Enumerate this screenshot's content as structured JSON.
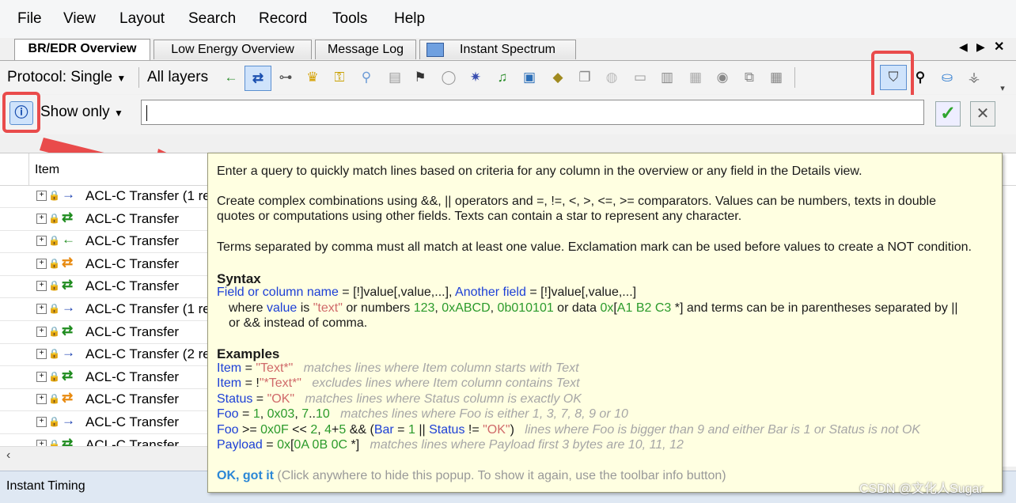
{
  "menu": [
    "File",
    "View",
    "Layout",
    "Search",
    "Record",
    "Tools",
    "Help"
  ],
  "tabs": [
    {
      "label": "BR/EDR Overview",
      "active": true
    },
    {
      "label": "Low Energy Overview"
    },
    {
      "label": "Message Log"
    },
    {
      "label": "Instant Spectrum"
    }
  ],
  "toolbar": {
    "protocol_label": "Protocol: Single",
    "layers_label": "All layers"
  },
  "filter": {
    "mode_label": "Show only",
    "query_value": ""
  },
  "grid": {
    "column_item": "Item",
    "rows": [
      {
        "text": "ACL-C Transfer (1 re",
        "dir": "right"
      },
      {
        "text": "ACL-C Transfer",
        "dir": "both"
      },
      {
        "text": "ACL-C Transfer",
        "dir": "left"
      },
      {
        "text": "ACL-C Transfer",
        "dir": "orange"
      },
      {
        "text": "ACL-C Transfer",
        "dir": "both"
      },
      {
        "text": "ACL-C Transfer (1 re",
        "dir": "right"
      },
      {
        "text": "ACL-C Transfer",
        "dir": "both"
      },
      {
        "text": "ACL-C Transfer (2 re",
        "dir": "right"
      },
      {
        "text": "ACL-C Transfer",
        "dir": "both"
      },
      {
        "text": "ACL-C Transfer",
        "dir": "orange"
      },
      {
        "text": "ACL-C Transfer",
        "dir": "right"
      },
      {
        "text": "ACL-C Transfer",
        "dir": "both"
      }
    ]
  },
  "status": {
    "label": "Instant Timing"
  },
  "popup": {
    "line1": "Enter a query to quickly match lines based on criteria for any column in the overview or any field in the Details view.",
    "line2": "Create complex combinations using &&, || operators and =, !=, <, >, <=, >= comparators. Values can be numbers, texts in double",
    "line3": "quotes or computations using other fields. Texts can contain a star to represent any character.",
    "line4": "Terms separated by comma must all match at least one value. Exclamation mark can be used before values to create a NOT condition.",
    "syntax_title": "Syntax",
    "syntax": {
      "f1": "Field or column name",
      "eq1": " = [!]value[,value,...], ",
      "f2": "Another field",
      "eq2": " = [!]value[,value,...]",
      "w1": "where ",
      "w_value": "value",
      "w2": " is ",
      "w_text": "\"text\"",
      "w3": " or numbers ",
      "n1": "123",
      "c1": ", ",
      "n2": "0xABCD",
      "c2": ", ",
      "n3": "0b010101",
      "w4": " or data ",
      "n4": "0x",
      "w5": "[",
      "n5": "A1 B2 C3",
      "w6": " *] and terms can be in parentheses separated by ||",
      "w7": "or && instead of comma."
    },
    "examples_title": "Examples",
    "ex": [
      {
        "f": "Item",
        "op": " = ",
        "v": "\"Text*\"",
        "c": "matches lines where Item column starts with Text"
      },
      {
        "f": "Item",
        "op": " = !",
        "v": "\"*Text*\"",
        "c": "excludes lines where Item column contains Text"
      },
      {
        "f": "Status",
        "op": " = ",
        "v": "\"OK\"",
        "c": "matches lines where Status column is exactly OK"
      }
    ],
    "ex4": {
      "f": "Foo",
      "a": " = ",
      "n1": "1",
      "b": ", ",
      "n2": "0x03",
      "d": ", ",
      "n3": "7",
      "e": "..",
      "n4": "10",
      "c": "matches lines where Foo is either 1, 3, 7, 8, 9 or 10"
    },
    "ex5": {
      "f": "Foo",
      "a": " >= ",
      "n1": "0x0F",
      "b": " << ",
      "n2": "2",
      "d": ", ",
      "n3": "4",
      "e": "+",
      "n4": "5",
      "g": " && (",
      "f2": "Bar",
      "h": " = ",
      "n5": "1",
      "i": " || ",
      "f3": "Status",
      "j": " != ",
      "v": "\"OK\"",
      "k": ")",
      "c": "lines where Foo is bigger than 9 and either Bar is 1 or Status is not OK"
    },
    "ex6": {
      "f": "Payload",
      "a": " = ",
      "n1": "0x",
      "b": "[",
      "n2": "0A 0B 0C",
      "d": " *]",
      "c": "matches lines where Payload first 3 bytes are 10, 11, 12"
    },
    "ok_label": "OK, got it",
    "hint": " (Click anywhere to hide this popup. To show it again, use the toolbar info button)"
  },
  "watermark": "CSDN @文化人Sugar",
  "colors": {
    "annotation_red": "#e94b4b",
    "link_blue": "#1c3fd6",
    "popup_bg": "#ffffe1"
  }
}
